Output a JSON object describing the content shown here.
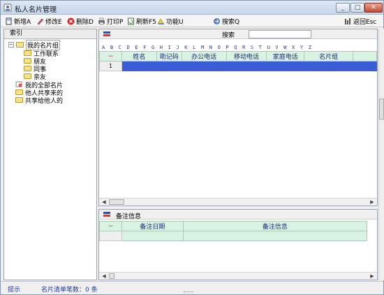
{
  "window": {
    "title": "私人名片管理",
    "min": "_",
    "max": "□",
    "close": "✕"
  },
  "toolbar": {
    "new_label": "新增A",
    "edit_label": "修改E",
    "delete_label": "删除D",
    "print_label": "打印P",
    "refresh_label": "刷新F5",
    "function_label": "功能U",
    "search_label": "搜索Q",
    "back_label": "返回Esc"
  },
  "left": {
    "header": "索引",
    "tree": {
      "my_group": "我的名片组",
      "children": [
        "工作联系",
        "朋友",
        "同事",
        "亲友"
      ],
      "all_cards": "我的全部名片",
      "shared_to_me": "他人共享来的",
      "shared_by_me": "共享给他人的"
    }
  },
  "main": {
    "search_label": "搜索",
    "search_value": "",
    "letters": [
      "A",
      "B",
      "C",
      "D",
      "E",
      "F",
      "G",
      "H",
      "I",
      "J",
      "K",
      "L",
      "M",
      "N",
      "O",
      "P",
      "Q",
      "R",
      "S",
      "T",
      "U",
      "V",
      "W",
      "X",
      "Y",
      "Z"
    ],
    "grid": {
      "corner": "−",
      "columns": [
        "姓名",
        "助记码",
        "办公电话",
        "移动电话",
        "家庭电话",
        "名片组"
      ],
      "rows": [
        {
          "num": "1"
        }
      ]
    }
  },
  "notes": {
    "title": "备注信息",
    "corner": "−",
    "columns": [
      "备注日期",
      "备注信息"
    ]
  },
  "status": {
    "hint": "提示",
    "count": "名片清单笔数：0 条"
  },
  "icons": {
    "app": "contacts-icon",
    "new": "new-doc-icon",
    "edit": "edit-icon",
    "delete": "delete-icon",
    "print": "printer-icon",
    "refresh": "refresh-icon",
    "function": "function-icon",
    "search": "search-icon",
    "back": "exit-icon",
    "flag": "flag-icon"
  },
  "colors": {
    "selection": "#3a5cd6",
    "grid_header": "#d9f2e4",
    "link_blue": "#1f3aa0"
  }
}
